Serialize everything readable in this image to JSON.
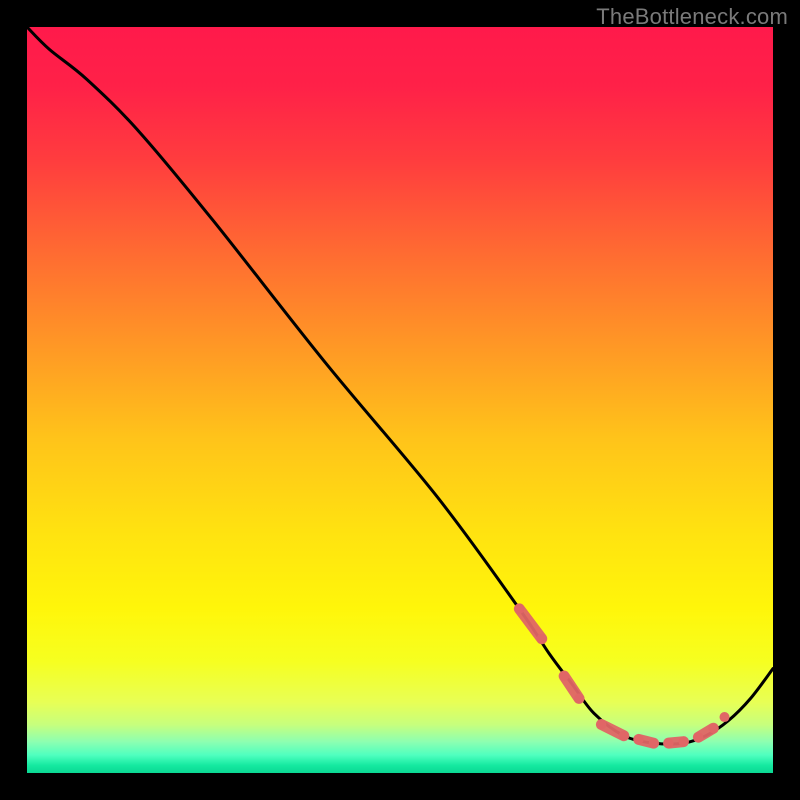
{
  "watermark": {
    "text": "TheBottleneck.com"
  },
  "gradient": {
    "stops": [
      {
        "offset": 0.0,
        "color": "#ff1a4b"
      },
      {
        "offset": 0.08,
        "color": "#ff2148"
      },
      {
        "offset": 0.18,
        "color": "#ff3d3e"
      },
      {
        "offset": 0.3,
        "color": "#ff6a32"
      },
      {
        "offset": 0.42,
        "color": "#ff9526"
      },
      {
        "offset": 0.55,
        "color": "#ffc31a"
      },
      {
        "offset": 0.68,
        "color": "#ffe310"
      },
      {
        "offset": 0.78,
        "color": "#fff60a"
      },
      {
        "offset": 0.85,
        "color": "#f6ff20"
      },
      {
        "offset": 0.905,
        "color": "#e8ff55"
      },
      {
        "offset": 0.935,
        "color": "#c7ff7d"
      },
      {
        "offset": 0.958,
        "color": "#8dffb1"
      },
      {
        "offset": 0.976,
        "color": "#4fffbf"
      },
      {
        "offset": 0.99,
        "color": "#14e9a0"
      },
      {
        "offset": 1.0,
        "color": "#0bd893"
      }
    ]
  },
  "chart_data": {
    "type": "line",
    "title": "",
    "xlabel": "",
    "ylabel": "",
    "xlim": [
      0,
      100
    ],
    "ylim": [
      0,
      100
    ],
    "series": [
      {
        "name": "bottleneck-curve",
        "x": [
          0,
          3,
          8,
          15,
          25,
          40,
          55,
          66,
          70,
          73,
          76,
          80,
          84,
          88,
          91,
          94,
          97,
          100
        ],
        "values": [
          100,
          97,
          93,
          86,
          74,
          55,
          37,
          22,
          16,
          12,
          8,
          5,
          4,
          4,
          5,
          7,
          10,
          14
        ]
      }
    ],
    "markers": {
      "name": "highlighted-range",
      "color": "#e06666",
      "points": [
        {
          "x": 66,
          "y": 22
        },
        {
          "x": 69,
          "y": 18
        },
        {
          "x": 72,
          "y": 13
        },
        {
          "x": 74,
          "y": 10
        },
        {
          "x": 77,
          "y": 6.5
        },
        {
          "x": 80,
          "y": 5
        },
        {
          "x": 82,
          "y": 4.5
        },
        {
          "x": 84,
          "y": 4
        },
        {
          "x": 86,
          "y": 4
        },
        {
          "x": 88,
          "y": 4.2
        },
        {
          "x": 90,
          "y": 4.8
        },
        {
          "x": 92,
          "y": 6
        },
        {
          "x": 93.5,
          "y": 7.5
        }
      ]
    }
  }
}
